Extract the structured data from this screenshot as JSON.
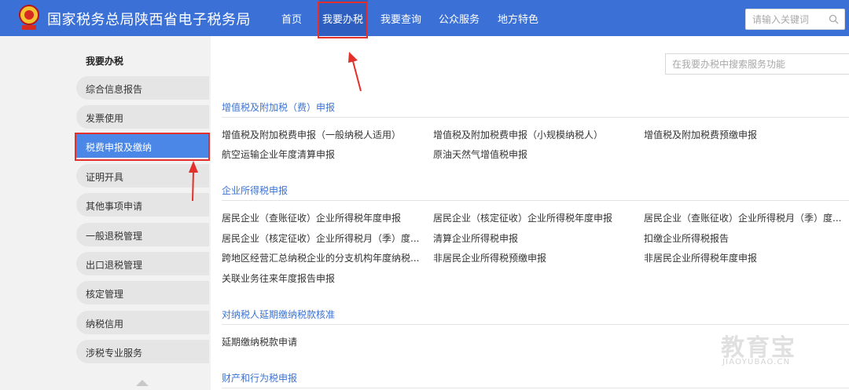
{
  "header": {
    "site_title": "国家税务总局陕西省电子税务局",
    "emblem_text": "中国税务",
    "nav": [
      {
        "label": "首页"
      },
      {
        "label": "我要办税"
      },
      {
        "label": "我要查询"
      },
      {
        "label": "公众服务"
      },
      {
        "label": "地方特色"
      }
    ],
    "search_placeholder": "请输入关键词"
  },
  "sidebar": {
    "title": "我要办税",
    "items": [
      {
        "label": "综合信息报告"
      },
      {
        "label": "发票使用"
      },
      {
        "label": "税费申报及缴纳",
        "active": true
      },
      {
        "label": "证明开具"
      },
      {
        "label": "其他事项申请"
      },
      {
        "label": "一般退税管理"
      },
      {
        "label": "出口退税管理"
      },
      {
        "label": "核定管理"
      },
      {
        "label": "纳税信用"
      },
      {
        "label": "涉税专业服务"
      }
    ]
  },
  "main": {
    "search_placeholder": "在我要办税中搜索服务功能",
    "sections": [
      {
        "title": "增值税及附加税（费）申报",
        "links": [
          "增值税及附加税费申报（一般纳税人适用）",
          "增值税及附加税费申报（小规模纳税人）",
          "增值税及附加税费预缴申报",
          "航空运输企业年度清算申报",
          "原油天然气增值税申报"
        ]
      },
      {
        "title": "企业所得税申报",
        "links": [
          "居民企业（查账征收）企业所得税年度申报",
          "居民企业（核定征收）企业所得税年度申报",
          "居民企业（查账征收）企业所得税月（季）度...",
          "居民企业（核定征收）企业所得税月（季）度...",
          "清算企业所得税申报",
          "扣缴企业所得税报告",
          "跨地区经营汇总纳税企业的分支机构年度纳税...",
          "非居民企业所得税预缴申报",
          "非居民企业所得税年度申报",
          "关联业务往来年度报告申报"
        ]
      },
      {
        "title": "对纳税人延期缴纳税款核准",
        "links": [
          "延期缴纳税款申请"
        ]
      },
      {
        "title": "财产和行为税申报",
        "links": []
      }
    ]
  },
  "watermark": {
    "main": "教育宝",
    "sub": "JIAOYUBAO.CN"
  },
  "colors": {
    "header_bg": "#3b71d6",
    "active_item": "#4a87e6",
    "section_title": "#3b73d4",
    "annotation": "#e3302a"
  }
}
